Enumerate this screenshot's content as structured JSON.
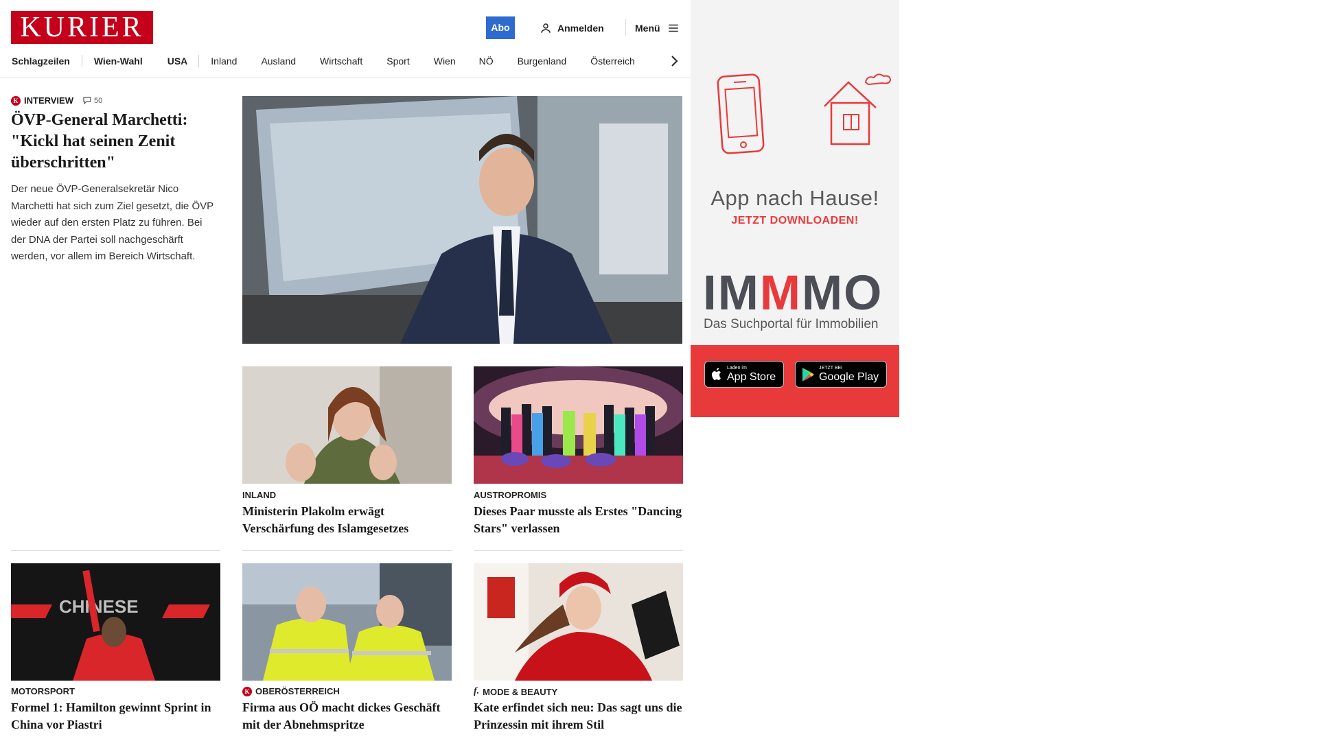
{
  "header": {
    "logo": "KURIER",
    "abo_label": "Abo",
    "login_label": "Anmelden",
    "menu_label": "Menü"
  },
  "nav": {
    "items": [
      "Schlagzeilen",
      "Wien-Wahl",
      "USA",
      "Inland",
      "Ausland",
      "Wirtschaft",
      "Sport",
      "Wien",
      "NÖ",
      "Burgenland",
      "Österreich"
    ]
  },
  "lead": {
    "kicker": "INTERVIEW",
    "comment_count": "50",
    "title": "ÖVP-General Marchetti: \"Kickl hat seinen Zenit überschritten\"",
    "text": "Der neue ÖVP-Generalsekretär Nico Marchetti hat sich zum Ziel gesetzt, die ÖVP wieder auf den ersten Platz zu führen. Bei der DNA der Partei soll nachgeschärft werden, vor allem im Bereich Wirtschaft."
  },
  "articles": [
    {
      "kicker": "INLAND",
      "title": "Ministerin Plakolm erwägt Verschärfung des Islamgesetzes"
    },
    {
      "kicker": "AUSTROPROMIS",
      "title": "Dieses Paar musste als Erstes \"Dancing Stars\" verlassen"
    },
    {
      "kicker": "MOTORSPORT",
      "title": "Formel 1: Hamilton gewinnt Sprint in China vor Piastri"
    },
    {
      "kicker": "OBERÖSTERREICH",
      "title": "Firma aus OÖ macht dickes Geschäft mit der Abnehmspritze"
    },
    {
      "kicker": "MODE & BEAUTY",
      "title": "Kate erfindet sich neu: Das sagt uns die Prinzessin mit ihrem Stil"
    }
  ],
  "ad": {
    "title": "App nach Hause!",
    "subtitle": "JETZT DOWNLOADEN!",
    "brand": "IMMMO",
    "tagline": "Das Suchportal für Immobilien",
    "appstore_small": "Laden im",
    "appstore_big": "App Store",
    "googleplay_small": "JETZT BEI",
    "googleplay_big": "Google Play"
  },
  "colors": {
    "brand_red": "#c5001a",
    "abo_blue": "#2e6bd1",
    "ad_red": "#e8393b"
  }
}
